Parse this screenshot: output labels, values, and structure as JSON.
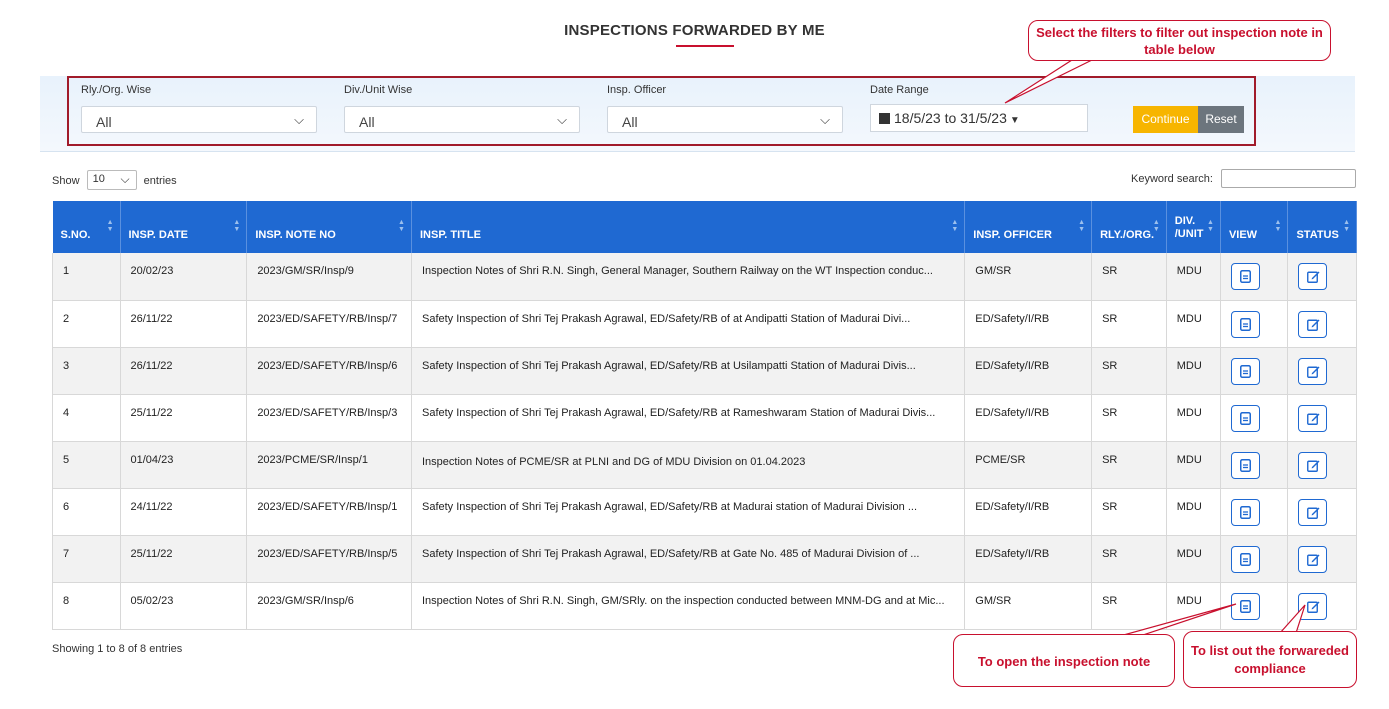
{
  "page": {
    "title": "INSPECTIONS FORWARDED BY ME"
  },
  "filters": {
    "rly_org": {
      "label": "Rly./Org. Wise",
      "value": "All"
    },
    "div_unit": {
      "label": "Div./Unit Wise",
      "value": "All"
    },
    "insp_officer": {
      "label": "Insp. Officer",
      "value": "All"
    },
    "date_range": {
      "label": "Date Range",
      "value": "18/5/23 to 31/5/23"
    },
    "continue_label": "Continue",
    "reset_label": "Reset"
  },
  "table_controls": {
    "show_label": "Show",
    "entries_value": "10",
    "entries_label": "entries",
    "keyword_label": "Keyword search:"
  },
  "table": {
    "columns": [
      "S.NO.",
      "INSP. DATE",
      "INSP. NOTE NO",
      "INSP. TITLE",
      "INSP. OFFICER",
      "RLY./ORG.",
      "DIV. /UNIT",
      "VIEW",
      "STATUS"
    ],
    "rows": [
      {
        "sno": "1",
        "date": "20/02/23",
        "note_no": "2023/GM/SR/Insp/9",
        "title": "Inspection Notes of Shri R.N. Singh, General Manager, Southern Railway on the WT Inspection conduc...",
        "officer": "GM/SR",
        "rly": "SR",
        "div": "MDU"
      },
      {
        "sno": "2",
        "date": "26/11/22",
        "note_no": "2023/ED/SAFETY/RB/Insp/7",
        "title": "Safety Inspection of Shri Tej Prakash Agrawal, ED/Safety/RB of at Andipatti Station of Madurai Divi...",
        "officer": "ED/Safety/I/RB",
        "rly": "SR",
        "div": "MDU"
      },
      {
        "sno": "3",
        "date": "26/11/22",
        "note_no": "2023/ED/SAFETY/RB/Insp/6",
        "title": "Safety Inspection of Shri Tej Prakash Agrawal, ED/Safety/RB at Usilampatti Station of Madurai Divis...",
        "officer": "ED/Safety/I/RB",
        "rly": "SR",
        "div": "MDU"
      },
      {
        "sno": "4",
        "date": "25/11/22",
        "note_no": "2023/ED/SAFETY/RB/Insp/3",
        "title": "Safety Inspection of Shri Tej Prakash Agrawal, ED/Safety/RB at Rameshwaram Station of Madurai Divis...",
        "officer": "ED/Safety/I/RB",
        "rly": "SR",
        "div": "MDU"
      },
      {
        "sno": "5",
        "date": "01/04/23",
        "note_no": "2023/PCME/SR/Insp/1",
        "title": "Inspection Notes of PCME/SR at PLNI and DG of MDU Division on 01.04.2023",
        "officer": "PCME/SR",
        "rly": "SR",
        "div": "MDU"
      },
      {
        "sno": "6",
        "date": "24/11/22",
        "note_no": "2023/ED/SAFETY/RB/Insp/1",
        "title": "Safety Inspection of Shri Tej Prakash Agrawal, ED/Safety/RB at Madurai station of Madurai Division ...",
        "officer": "ED/Safety/I/RB",
        "rly": "SR",
        "div": "MDU"
      },
      {
        "sno": "7",
        "date": "25/11/22",
        "note_no": "2023/ED/SAFETY/RB/Insp/5",
        "title": "Safety Inspection of Shri Tej Prakash Agrawal, ED/Safety/RB at Gate No. 485 of Madurai Division of ...",
        "officer": "ED/Safety/I/RB",
        "rly": "SR",
        "div": "MDU"
      },
      {
        "sno": "8",
        "date": "05/02/23",
        "note_no": "2023/GM/SR/Insp/6",
        "title": "Inspection Notes of Shri R.N. Singh, GM/SRly. on the inspection conducted between MNM-DG and at Mic...",
        "officer": "GM/SR",
        "rly": "SR",
        "div": "MDU"
      }
    ]
  },
  "footer": {
    "showing_text": "Showing 1 to 8 of 8 entries"
  },
  "annotations": {
    "filters_note": "Select the filters to filter out inspection note in table below",
    "view_note": "To open the inspection note",
    "status_note": "To list out the forwareded compliance"
  },
  "colors": {
    "header_blue": "#1f69d2",
    "annotation_red": "#c8102e",
    "continue_yellow": "#f7b500",
    "reset_gray": "#6c757d"
  },
  "icons": {
    "view": "document-icon",
    "status": "edit-icon",
    "date": "calendar-icon"
  }
}
